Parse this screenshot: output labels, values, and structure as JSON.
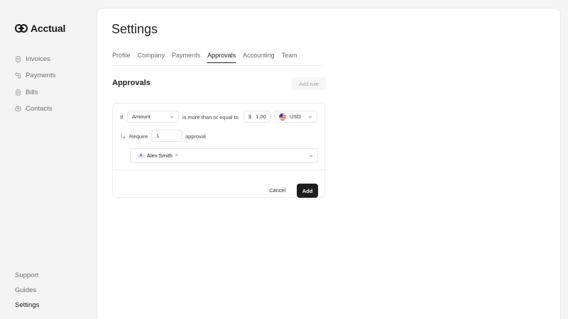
{
  "brand": {
    "name": "Acctual",
    "icon": "acctual-logo-icon"
  },
  "sidebar": {
    "items": [
      {
        "label": "Invoices",
        "icon": "invoice-icon"
      },
      {
        "label": "Payments",
        "icon": "payments-icon"
      },
      {
        "label": "Bills",
        "icon": "bills-icon"
      },
      {
        "label": "Contacts",
        "icon": "contacts-icon"
      }
    ],
    "bottom": [
      {
        "label": "Support"
      },
      {
        "label": "Guides"
      },
      {
        "label": "Settings",
        "active": true
      }
    ]
  },
  "page": {
    "title": "Settings"
  },
  "tabs": [
    {
      "label": "Profile"
    },
    {
      "label": "Company"
    },
    {
      "label": "Payments"
    },
    {
      "label": "Approvals",
      "active": true
    },
    {
      "label": "Accounting"
    },
    {
      "label": "Team"
    }
  ],
  "approvals": {
    "title": "Approvals",
    "add_rule_label": "Add rule",
    "rule": {
      "if_label": "If",
      "field_value": "Amount",
      "operator_text": "is more than or equal to",
      "currency_symbol": "$",
      "amount_value": "1.00",
      "currency_value": "USD",
      "require_label": "Require",
      "require_count": "1",
      "approval_label": "approval",
      "approvers": [
        {
          "initial": "A",
          "name": "Alex Smith",
          "remove": "×"
        }
      ]
    },
    "cancel_label": "Cancel",
    "add_label": "Add"
  },
  "colors": {
    "primary_button": "#1f1f1f",
    "background": "#f4f4f4",
    "panel": "#ffffff"
  }
}
